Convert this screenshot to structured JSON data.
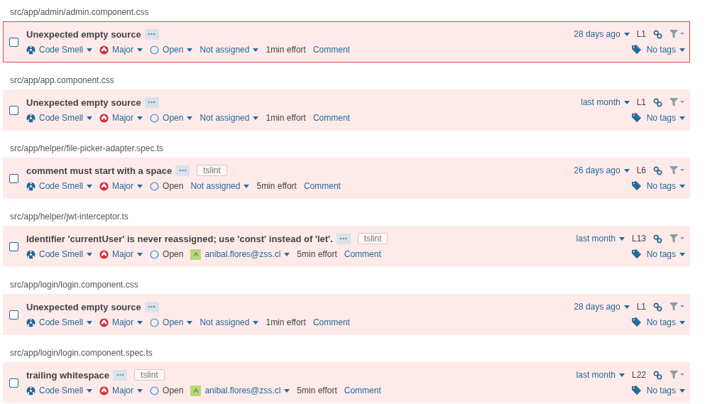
{
  "issues": [
    {
      "file": "src/app/admin/admin.component.css",
      "message": "Unexpected empty source",
      "selected": true,
      "checked": false,
      "type": "Code Smell",
      "severity": "Major",
      "status": "Open",
      "status_editable": true,
      "assignee": "Not assigned",
      "effort": "1min effort",
      "comment": "Comment",
      "date": "28 days ago",
      "line": "L1",
      "tags": "No tags"
    },
    {
      "file": "src/app/app.component.css",
      "message": "Unexpected empty source",
      "selected": false,
      "checked": false,
      "type": "Code Smell",
      "severity": "Major",
      "status": "Open",
      "status_editable": true,
      "assignee": "Not assigned",
      "effort": "1min effort",
      "comment": "Comment",
      "date": "last month",
      "line": "L1",
      "tags": "No tags"
    },
    {
      "file": "src/app/helper/file-picker-adapter.spec.ts",
      "message": "comment must start with a space",
      "tag": "tslint",
      "selected": false,
      "checked": false,
      "type": "Code Smell",
      "severity": "Major",
      "status": "Open",
      "status_editable": false,
      "assignee": "Not assigned",
      "effort": "5min effort",
      "comment": "Comment",
      "date": "26 days ago",
      "line": "L6",
      "tags": "No tags"
    },
    {
      "file": "src/app/helper/jwt-interceptor.ts",
      "message": "Identifier 'currentUser' is never reassigned; use 'const' instead of 'let'.",
      "tag": "tslint",
      "selected": false,
      "checked": false,
      "type": "Code Smell",
      "severity": "Major",
      "status": "Open",
      "status_editable": false,
      "assignee": "anibal.flores@zss.cl",
      "avatar": "A",
      "effort": "5min effort",
      "comment": "Comment",
      "date": "last month",
      "line": "L13",
      "tags": "No tags"
    },
    {
      "file": "src/app/login/login.component.css",
      "message": "Unexpected empty source",
      "selected": false,
      "checked": false,
      "type": "Code Smell",
      "severity": "Major",
      "status": "Open",
      "status_editable": true,
      "assignee": "Not assigned",
      "effort": "1min effort",
      "comment": "Comment",
      "date": "28 days ago",
      "line": "L1",
      "tags": "No tags"
    },
    {
      "file": "src/app/login/login.component.spec.ts",
      "message": "trailing whitespace",
      "tag": "tslint",
      "selected": false,
      "checked": false,
      "type": "Code Smell",
      "severity": "Major",
      "status": "Open",
      "status_editable": false,
      "assignee": "anibal.flores@zss.cl",
      "avatar": "A",
      "effort": "5min effort",
      "comment": "Comment",
      "date": "last month",
      "line": "L22",
      "tags": "No tags"
    }
  ]
}
